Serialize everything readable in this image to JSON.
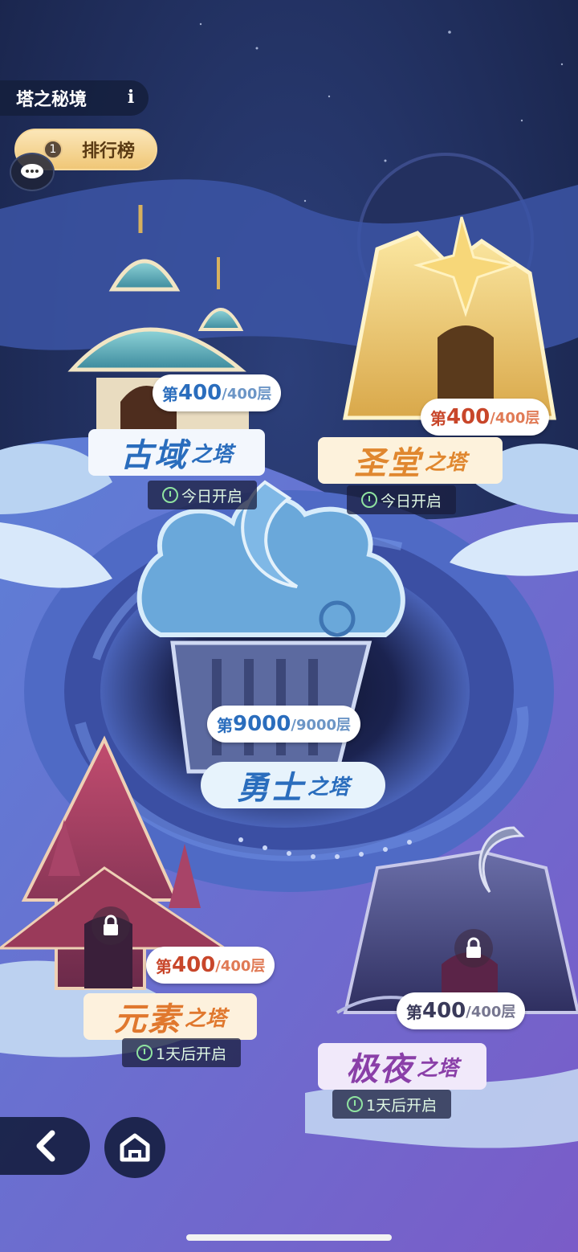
{
  "header": {
    "title": "塔之秘境",
    "info_glyph": "i",
    "ranking_label": "排行榜",
    "ranking_badge": "1"
  },
  "towers": [
    {
      "name_main": "古域",
      "name_sub": "之塔",
      "floor_prefix": "第",
      "floor_current": "400",
      "floor_max": "/400层",
      "status": "今日开启",
      "locked": false,
      "accent": "#2a6dbd"
    },
    {
      "name_main": "圣堂",
      "name_sub": "之塔",
      "floor_prefix": "第",
      "floor_current": "400",
      "floor_max": "/400层",
      "status": "今日开启",
      "locked": false,
      "accent": "#c8462a"
    },
    {
      "name_main": "勇士",
      "name_sub": "之塔",
      "floor_prefix": "第",
      "floor_current": "9000",
      "floor_max": "/9000层",
      "status": "",
      "locked": false,
      "accent": "#2a6dbd"
    },
    {
      "name_main": "元素",
      "name_sub": "之塔",
      "floor_prefix": "第",
      "floor_current": "400",
      "floor_max": "/400层",
      "status": "1天后开启",
      "locked": true,
      "accent": "#c8462a"
    },
    {
      "name_main": "极夜",
      "name_sub": "之塔",
      "floor_prefix": "第",
      "floor_current": "400",
      "floor_max": "/400层",
      "status": "1天后开启",
      "locked": true,
      "accent": "#8a3fa8"
    }
  ],
  "icons": {
    "back": "chevron-left-icon",
    "home": "home-icon",
    "chat": "chat-bubble-icon",
    "lock": "lock-icon",
    "clock": "clock-icon"
  }
}
